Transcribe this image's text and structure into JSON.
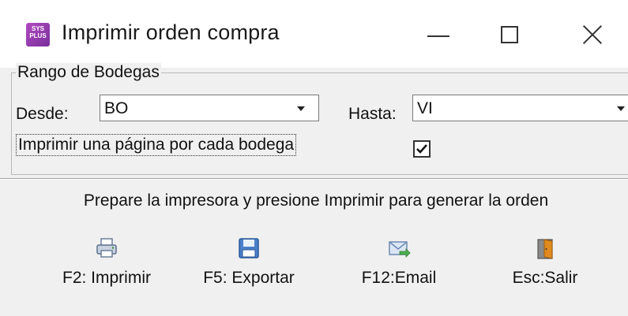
{
  "window": {
    "title": "Imprimir orden compra",
    "icon_text": "SYS PLUS"
  },
  "controls": {
    "minimize": "minimize-icon",
    "maximize": "maximize-icon",
    "close": "close-icon"
  },
  "range": {
    "group_label": "Rango de Bodegas",
    "from_label": "Desde:",
    "from_value": "BO",
    "to_label": "Hasta:",
    "to_value": "VI"
  },
  "options": {
    "one_page_per_warehouse_label": "Imprimir una página por cada bodega",
    "one_page_per_warehouse_checked": true
  },
  "message": "Prepare la impresora y presione Imprimir para generar la orden",
  "buttons": [
    {
      "label": "F2: Imprimir",
      "icon": "printer-icon"
    },
    {
      "label": "F5: Exportar",
      "icon": "floppy-disk-icon"
    },
    {
      "label": "F12:Email",
      "icon": "email-icon"
    },
    {
      "label": "Esc:Salir",
      "icon": "exit-door-icon"
    }
  ],
  "colors": {
    "background": "#f0f0f0",
    "titlebar": "#ffffff",
    "app_icon": "#9b3fb5"
  }
}
